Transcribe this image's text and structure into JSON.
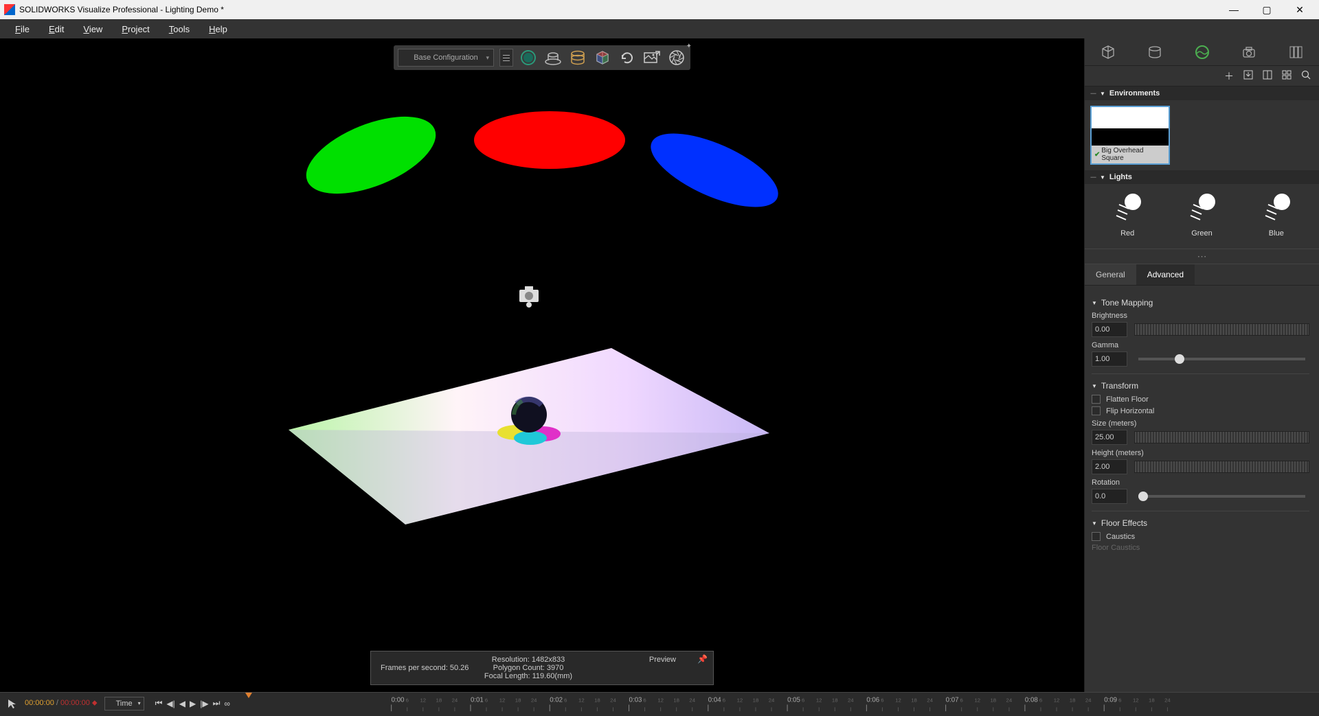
{
  "titlebar": {
    "title": "SOLIDWORKS Visualize Professional - Lighting Demo *"
  },
  "menu": {
    "file": "File",
    "edit": "Edit",
    "view": "View",
    "project": "Project",
    "tools": "Tools",
    "help": "Help"
  },
  "toolbar": {
    "config": "Base Configuration"
  },
  "stats": {
    "fps_label": "Frames per second: 50.26",
    "resolution": "Resolution: 1482x833",
    "polycount": "Polygon Count: 3970",
    "focal": "Focal Length: 119.60(mm)",
    "mode": "Preview"
  },
  "timeline": {
    "current": "00:00:00",
    "end": "00:00:00",
    "mode": "Time",
    "ticks": [
      "0:00",
      "0:01",
      "0:02",
      "0:03",
      "0:04",
      "0:05",
      "0:06",
      "0:07",
      "0:08",
      "0:09"
    ]
  },
  "panel": {
    "sections": {
      "environments": "Environments",
      "lights": "Lights"
    },
    "env_name": "Big Overhead Square",
    "lights": [
      {
        "name": "Red"
      },
      {
        "name": "Green"
      },
      {
        "name": "Blue"
      }
    ],
    "tabs": {
      "general": "General",
      "advanced": "Advanced"
    },
    "tone_mapping": {
      "header": "Tone Mapping",
      "brightness_label": "Brightness",
      "brightness": "0.00",
      "gamma_label": "Gamma",
      "gamma": "1.00"
    },
    "transform": {
      "header": "Transform",
      "flatten": "Flatten Floor",
      "flip": "Flip Horizontal",
      "size_label": "Size (meters)",
      "size": "25.00",
      "height_label": "Height (meters)",
      "height": "2.00",
      "rotation_label": "Rotation",
      "rotation": "0.0"
    },
    "floor": {
      "header": "Floor Effects",
      "caustics": "Caustics",
      "floor_caustics": "Floor Caustics"
    }
  }
}
